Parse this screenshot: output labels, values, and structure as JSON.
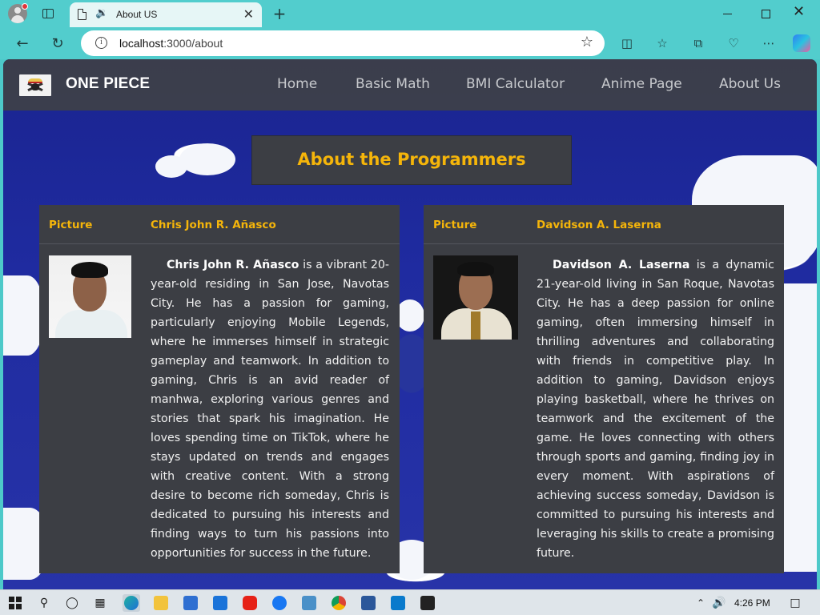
{
  "browser": {
    "tab_title": "About US",
    "url_host": "localhost",
    "url_rest": ":3000/about"
  },
  "site": {
    "brand": "ONE PIECE",
    "nav": [
      "Home",
      "Basic Math",
      "BMI Calculator",
      "Anime Page",
      "About Us"
    ]
  },
  "page": {
    "title": "About the Programmers",
    "programmers": [
      {
        "picture_label": "Picture",
        "name": "Chris John R. Añasco",
        "bio": "is a vibrant 20-year-old residing in San Jose, Navotas City. He has a passion for gaming, particularly enjoying Mobile Legends, where he immerses himself in strategic gameplay and teamwork. In addition to gaming, Chris is an avid reader of manhwa, exploring various genres and stories that spark his imagination. He loves spending time on TikTok, where he stays updated on trends and engages with creative content. With a strong desire to become rich someday, Chris is dedicated to pursuing his interests and finding ways to turn his passions into opportunities for success in the future."
      },
      {
        "picture_label": "Picture",
        "name": "Davidson A. Laserna",
        "bio": "is a dynamic 21-year-old living in San Roque, Navotas City. He has a deep passion for online gaming, often immersing himself in thrilling adventures and collaborating with friends in competitive play. In addition to gaming, Davidson enjoys playing basketball, where he thrives on teamwork and the excitement of the game. He loves connecting with others through sports and gaming, finding joy in every moment. With aspirations of achieving success someday, Davidson is committed to pursuing his interests and leveraging his skills to create a promising future."
      }
    ]
  },
  "taskbar": {
    "clock": "4:26 PM"
  },
  "colors": {
    "accent": "#f5b50a",
    "card_bg": "#3c3e44",
    "header_bg": "#3e4046",
    "browser_chrome": "#52cdcd"
  }
}
